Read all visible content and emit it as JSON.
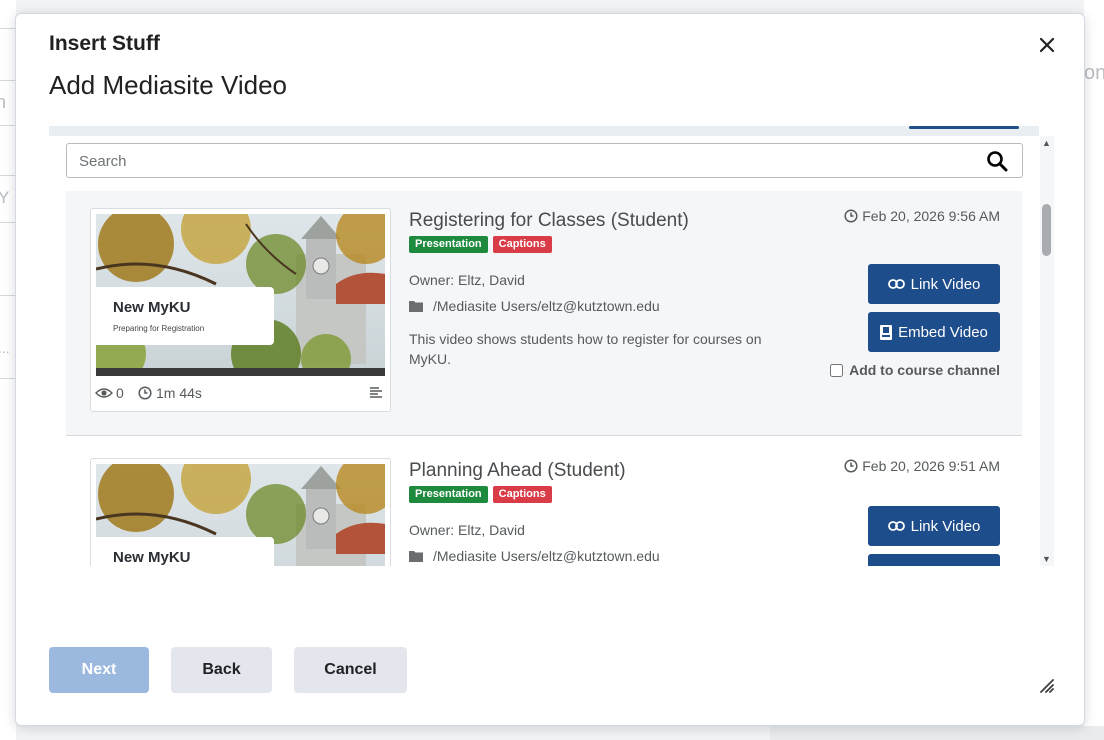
{
  "background": {
    "fragments": [
      "on",
      "Y",
      "n",
      "..."
    ]
  },
  "dialog": {
    "title": "Insert Stuff",
    "subtitle": "Add Mediasite Video",
    "close_icon": "close-icon"
  },
  "search": {
    "placeholder": "Search",
    "icon": "search-icon"
  },
  "videos": [
    {
      "title": "Registering for Classes (Student)",
      "tags": [
        "Presentation",
        "Captions"
      ],
      "date": "Feb 20, 2026 9:56 AM",
      "owner": "Owner: Eltz, David",
      "folder": "/Mediasite Users/eltz@kutztown.edu",
      "description": "This video shows students how to register for courses on MyKU.",
      "thumb_title": "New MyKU",
      "thumb_subtitle": "Preparing for Registration",
      "views": "0",
      "duration": "1m 44s",
      "link_label": "Link Video",
      "embed_label": "Embed Video",
      "channel_label": "Add to course channel",
      "channel_checked": false
    },
    {
      "title": "Planning Ahead (Student)",
      "tags": [
        "Presentation",
        "Captions"
      ],
      "date": "Feb 20, 2026 9:51 AM",
      "owner": "Owner: Eltz, David",
      "folder": "/Mediasite Users/eltz@kutztown.edu",
      "thumb_title": "New MyKU",
      "link_label": "Link Video"
    }
  ],
  "footer": {
    "next_label": "Next",
    "back_label": "Back",
    "cancel_label": "Cancel"
  },
  "colors": {
    "primary_button": "#1e4d8c",
    "tag_presentation": "#1d8a3e",
    "tag_captions": "#d93b47",
    "next_disabled": "#9bb8de",
    "secondary_button": "#e3e6ed"
  }
}
